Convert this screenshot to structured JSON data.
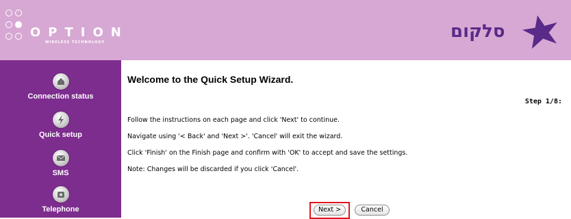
{
  "header": {
    "vendor_name": "OPTION",
    "vendor_tagline": "WIRELESS TECHNOLOGY",
    "brand_name": "סלקום",
    "colors": {
      "header_bg": "#d7a8d3",
      "sidebar_bg": "#7d2d8e",
      "highlight": "#e0121b"
    }
  },
  "sidebar": {
    "items": [
      {
        "label": "Connection status",
        "icon": "home-icon"
      },
      {
        "label": "Quick setup",
        "icon": "lightning-icon"
      },
      {
        "label": "SMS",
        "icon": "envelope-icon"
      },
      {
        "label": "Telephone",
        "icon": "telephone-icon"
      }
    ]
  },
  "main": {
    "title": "Welcome to the Quick Setup Wizard.",
    "step": "Step 1/8:",
    "instructions": [
      "Follow the instructions on each page and click 'Next' to continue.",
      "Navigate using '< Back' and 'Next >'. 'Cancel' will exit the wizard.",
      "Click 'Finish' on the Finish page and confirm with 'OK' to accept and save the settings.",
      "Note: Changes will be discarded if you click 'Cancel'."
    ],
    "buttons": {
      "next_label": "Next >",
      "cancel_label": "Cancel"
    }
  }
}
